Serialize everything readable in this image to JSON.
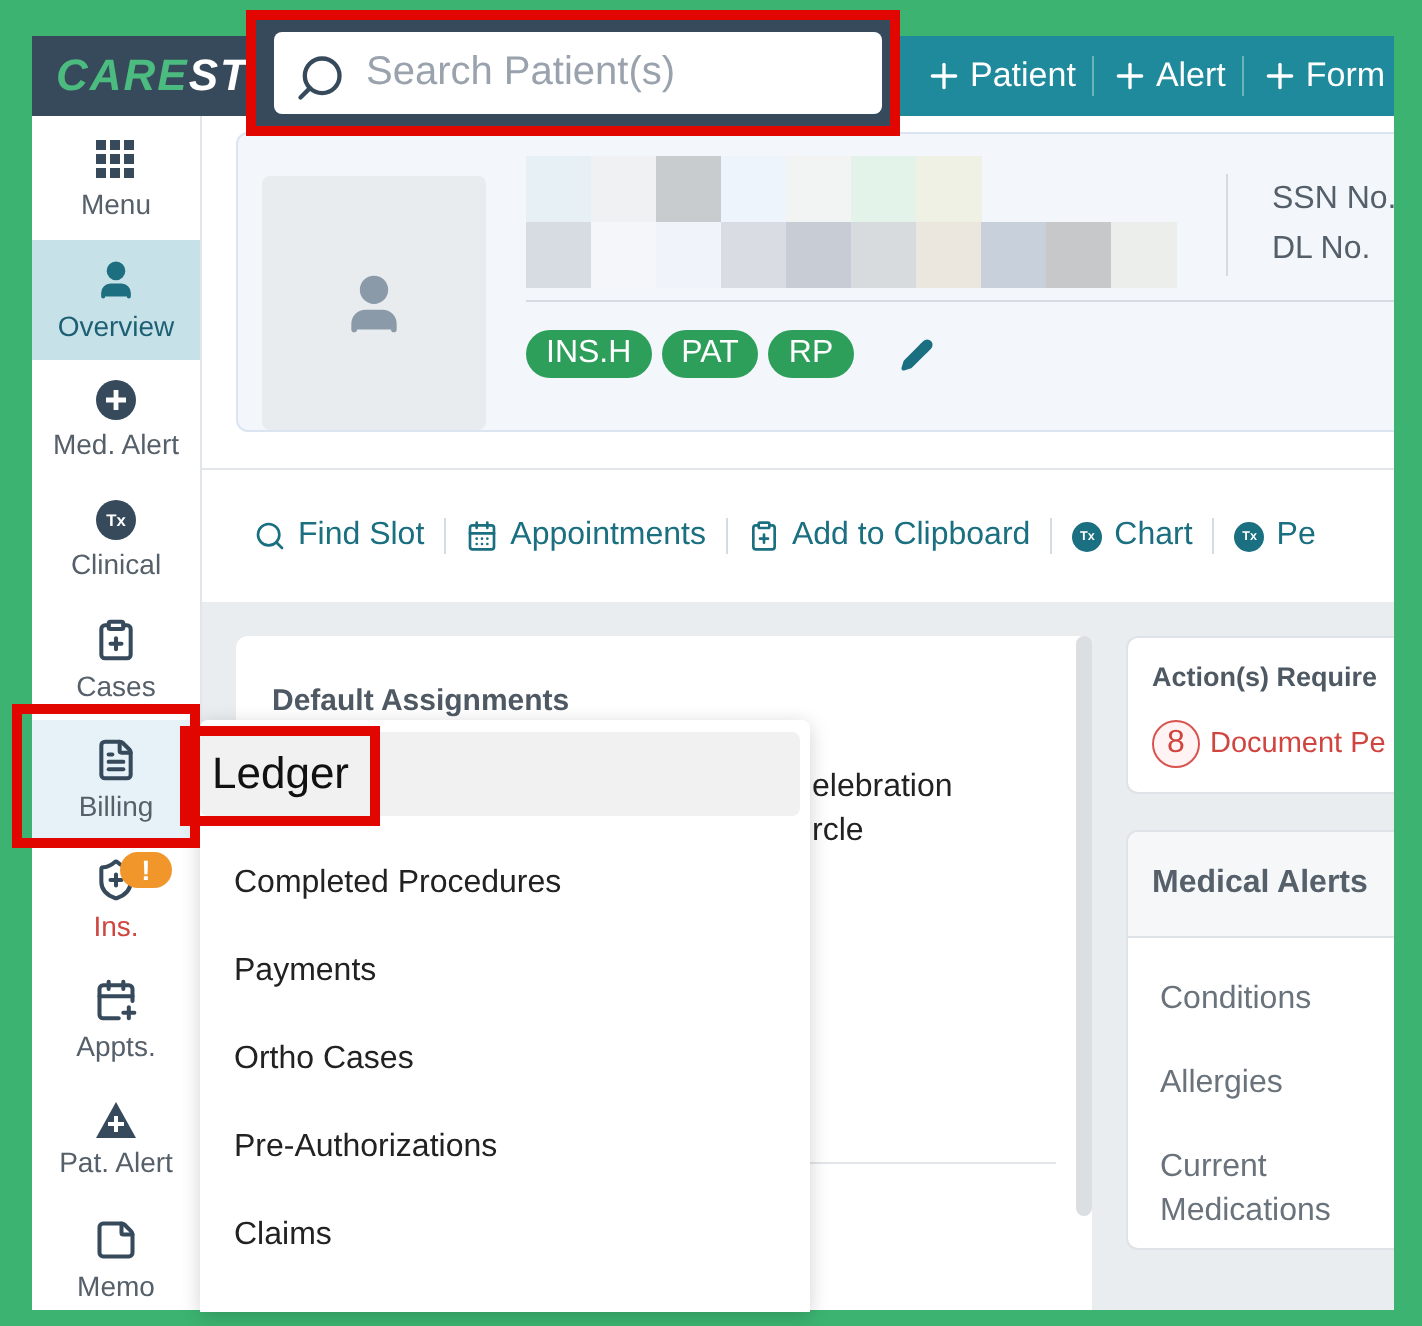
{
  "logo": {
    "part_1": "CARE",
    "part_2": "ST"
  },
  "search": {
    "placeholder": "Search Patient(s)",
    "highlighted": true
  },
  "quick_add": [
    "Patient",
    "Alert",
    "Form"
  ],
  "sidebar": {
    "items": [
      {
        "label": "Menu",
        "selected": false,
        "highlighted": false,
        "warning": false
      },
      {
        "label": "Overview",
        "selected": true,
        "highlighted": false,
        "warning": false
      },
      {
        "label": "Med. Alert",
        "selected": false,
        "highlighted": false,
        "warning": false
      },
      {
        "label": "Clinical",
        "selected": false,
        "highlighted": false,
        "warning": false,
        "icon_text": "Tx"
      },
      {
        "label": "Cases",
        "selected": false,
        "highlighted": false,
        "warning": false
      },
      {
        "label": "Billing",
        "selected": false,
        "highlighted": true,
        "warning": false
      },
      {
        "label": "Ins.",
        "selected": false,
        "highlighted": false,
        "warning": true,
        "badge": "!"
      },
      {
        "label": "Appts.",
        "selected": false,
        "highlighted": false,
        "warning": false
      },
      {
        "label": "Pat. Alert",
        "selected": false,
        "highlighted": false,
        "warning": false
      },
      {
        "label": "Memo",
        "selected": false,
        "highlighted": false,
        "warning": false
      }
    ]
  },
  "patient": {
    "fields": [
      "SSN No.",
      "DL No."
    ],
    "tags": [
      "INS.H",
      "PAT",
      "RP"
    ]
  },
  "actions": [
    {
      "label": "Find Slot"
    },
    {
      "label": "Appointments"
    },
    {
      "label": "Add to Clipboard"
    },
    {
      "label": "Chart",
      "icon_text": "Tx"
    },
    {
      "label": "Pe",
      "icon_text": "Tx"
    }
  ],
  "default_assignments": {
    "title": "Default Assignments",
    "lines": [
      "elebration",
      "rcle"
    ]
  },
  "action_required": {
    "title": "Action(s) Require",
    "count": "8",
    "label": "Document Pe"
  },
  "medical_alerts": {
    "title": "Medical Alerts",
    "items": [
      "Conditions",
      "Allergies",
      "Current Medications"
    ]
  },
  "billing_menu": {
    "items": [
      {
        "label": "Ledger",
        "selected": true,
        "highlighted": true
      },
      {
        "label": "Completed Procedures",
        "selected": false,
        "highlighted": false
      },
      {
        "label": "Payments",
        "selected": false,
        "highlighted": false
      },
      {
        "label": "Ortho Cases",
        "selected": false,
        "highlighted": false
      },
      {
        "label": "Pre-Authorizations",
        "selected": false,
        "highlighted": false
      },
      {
        "label": "Claims",
        "selected": false,
        "highlighted": false
      }
    ]
  }
}
